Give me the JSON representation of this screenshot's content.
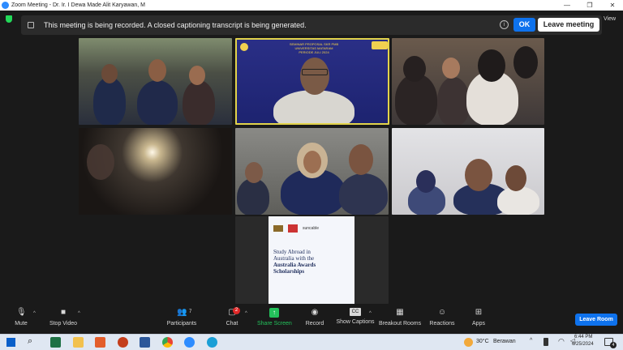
{
  "window": {
    "title": "Zoom Meeting - Dr. Ir. I Dewa Made Alit Karyawan, M",
    "controls": [
      "—",
      "❐",
      "✕"
    ]
  },
  "header": {
    "view_label": "View"
  },
  "banner": {
    "message": "This meeting is being recorded. A closed captioning transcript is being generated.",
    "info_icon": "i",
    "ok_label": "OK",
    "leave_label": "Leave meeting"
  },
  "presenter_tile": {
    "line1": "SEMINAR PROPOSAL SKR PMB",
    "line2": "UNIVERSITAS MATARAM",
    "line3": "PERIODE JULI 2024"
  },
  "shared_slide": {
    "logo_suncable": "suncable",
    "title_line1": "Study Abroad in",
    "title_line2": "Australia with the",
    "title_bold1": "Australia Awards",
    "title_bold2": "Scholarships"
  },
  "toolbar": {
    "mute": "Mute",
    "stop_video": "Stop Video",
    "participants": "Participants",
    "participants_count": "7",
    "chat": "Chat",
    "chat_badge": "2",
    "share_screen": "Share Screen",
    "record": "Record",
    "show_captions": "Show Captions",
    "breakout_rooms": "Breakout Rooms",
    "reactions": "Reactions",
    "apps": "Apps",
    "leave_room": "Leave Room"
  },
  "taskbar": {
    "temperature": "30°C",
    "weather": "Berawan",
    "time": "6:44 PM",
    "date": "6/25/2024",
    "notification_count": "4"
  },
  "colors": {
    "accent": "#0e72ed",
    "share_green": "#23c15b",
    "badge_red": "#e02828"
  }
}
